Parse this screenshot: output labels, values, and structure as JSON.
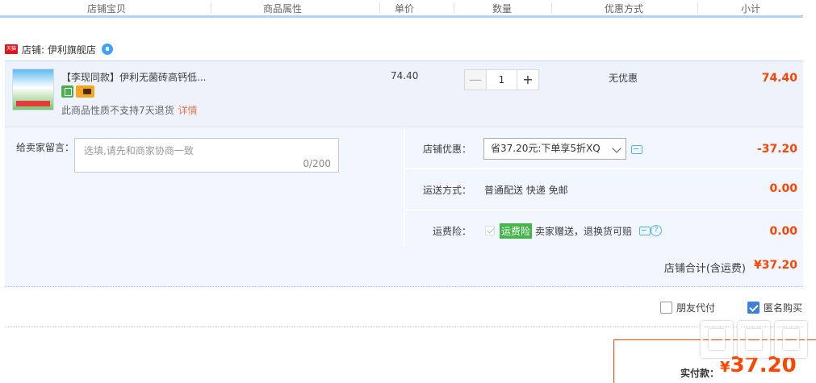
{
  "table_header": {
    "cols": [
      "店铺宝贝",
      "商品属性",
      "单价",
      "数量",
      "优惠方式",
      "小计"
    ]
  },
  "shop": {
    "label": "店铺: 伊利旗舰店",
    "badge_text": "天猫"
  },
  "item": {
    "title": "【李现同款】伊利无菌砖高钙低...",
    "notice": "此商品性质不支持7天退货",
    "detail_link": "详情",
    "unit_price": "74.40",
    "quantity": "1",
    "qty_minus": "—",
    "qty_plus": "+",
    "discount_method": "无优惠",
    "subtotal": "74.40"
  },
  "message": {
    "label": "给卖家留言：",
    "placeholder": "选填,请先和商家协商一致",
    "counter": "0/200"
  },
  "shop_discount": {
    "label": "店铺优惠：",
    "selected": "省37.20元:下单享5折XQ",
    "amount": "-37.20"
  },
  "shipping": {
    "label": "运送方式：",
    "value": "普通配送 快递 免邮",
    "amount": "0.00"
  },
  "insurance": {
    "label": "运费险：",
    "badge": "运费险",
    "text": "卖家赠送，退换货可赔",
    "help_glyph": "?",
    "amount": "0.00"
  },
  "shop_total": {
    "label": "店铺合计(含运费)",
    "amount": "¥37.20"
  },
  "options": {
    "friend_pay": {
      "label": "朋友代付",
      "checked": false
    },
    "anonymous": {
      "label": "匿名购买",
      "checked": true
    }
  },
  "payment": {
    "label": "实付款：",
    "currency": "¥",
    "amount": "37.20"
  },
  "colors": {
    "price_red": "#ff4400",
    "header_border": "#b2d1ff",
    "row_bg": "#eef3fb",
    "panel_bg": "#f2f7ff",
    "check_blue": "#3d7fd9",
    "insurance_green": "#44b549"
  }
}
